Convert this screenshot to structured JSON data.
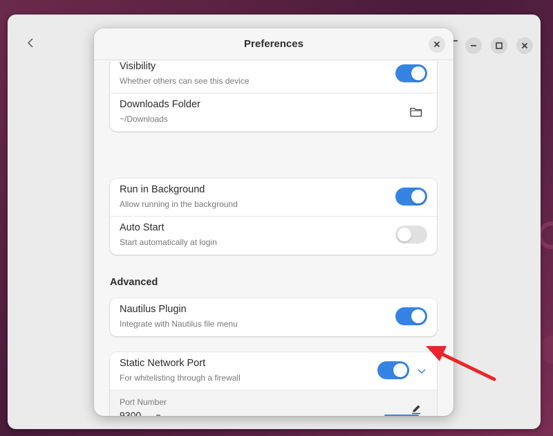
{
  "window": {
    "back_icon": "chevron-left-icon",
    "controls": [
      "minimize-icon",
      "maximize-icon",
      "close-icon"
    ]
  },
  "dialog": {
    "title": "Preferences",
    "close_icon": "close-icon",
    "group1": {
      "visibility": {
        "title": "Visibility",
        "subtitle": "Whether others can see this device",
        "enabled": true
      },
      "downloads": {
        "title": "Downloads Folder",
        "subtitle": "~/Downloads",
        "icon": "folder-icon"
      }
    },
    "group2": {
      "background": {
        "title": "Run in Background",
        "subtitle": "Allow running in the background",
        "enabled": true
      },
      "autostart": {
        "title": "Auto Start",
        "subtitle": "Start automatically at login",
        "enabled": false
      }
    },
    "advanced": {
      "heading": "Advanced",
      "nautilus": {
        "title": "Nautilus Plugin",
        "subtitle": "Integrate with Nautilus file menu",
        "enabled": true
      },
      "static_port": {
        "title": "Static Network Port",
        "subtitle": "For whitelisting through a firewall",
        "enabled": true,
        "expand_icon": "chevron-down-icon",
        "port_label": "Port Number",
        "port_value": "9300",
        "edit_icon": "edit-icon"
      }
    }
  },
  "colors": {
    "accent": "#3584e4",
    "annotation": "#e8262a"
  }
}
